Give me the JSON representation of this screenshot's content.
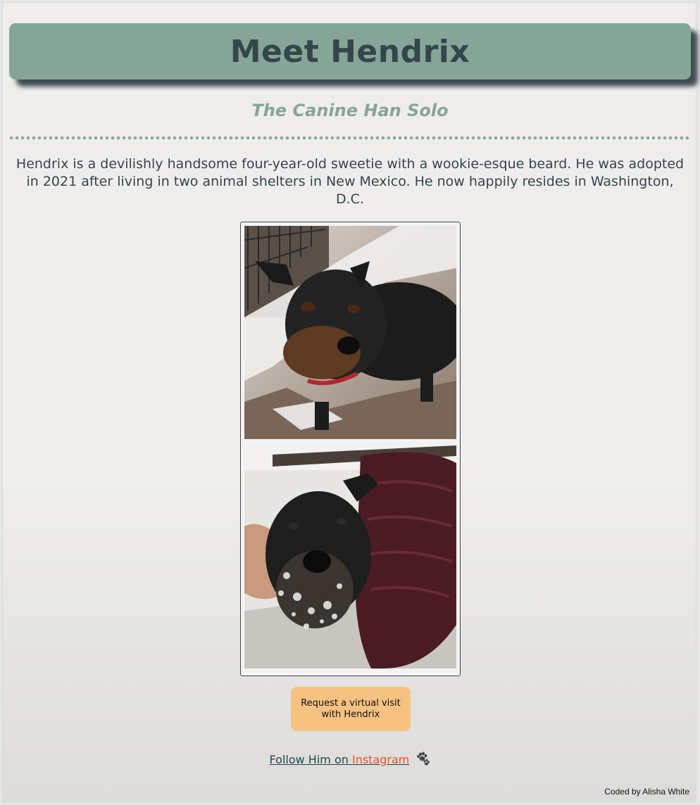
{
  "header": {
    "title": "Meet Hendrix"
  },
  "subtitle": "The Canine Han Solo",
  "intro": "Hendrix is a devilishly handsome four-year-old sweetie with a wookie-esque beard. He was adopted in 2021 after living in two animal shelters in New Mexico. He now happily resides in Washington, D.C.",
  "photos": [
    {
      "name": "hendrix-photo-snow-yard"
    },
    {
      "name": "hendrix-photo-red-jacket"
    }
  ],
  "cta": {
    "label": "Request a virtual visit with Hendrix"
  },
  "follow": {
    "prefix": "Follow Him on ",
    "link_label": "Instagram",
    "icon": "paw-prints-icon"
  },
  "footer": {
    "credit": "Coded by Alisha White"
  },
  "colors": {
    "header_bg": "#85a697",
    "text": "#34454b",
    "accent_button": "#f6c282",
    "link_accent": "#e8512a"
  }
}
